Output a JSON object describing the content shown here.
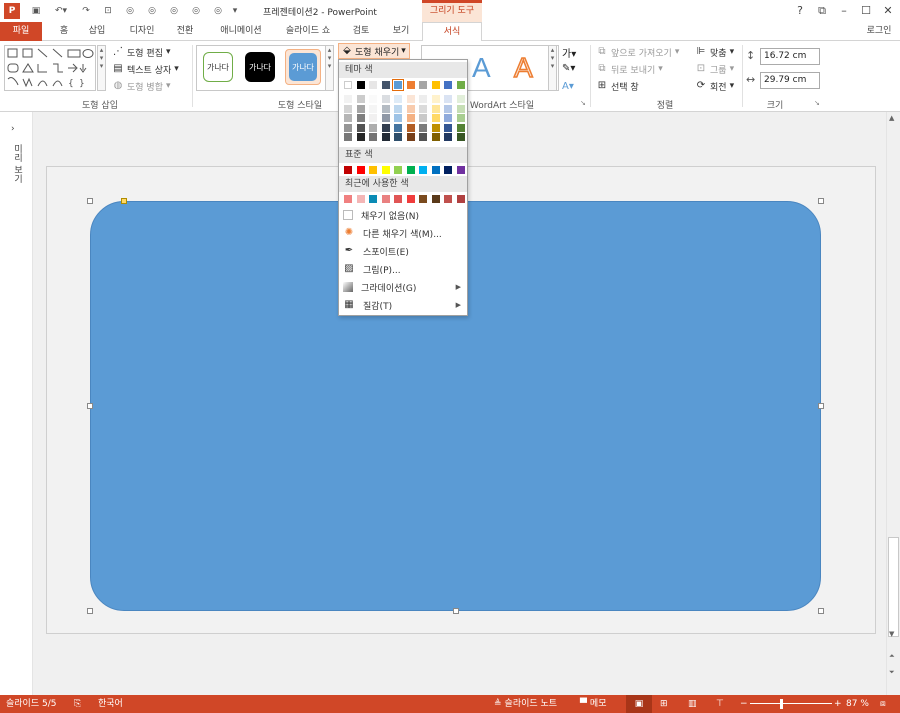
{
  "titlebar": {
    "title": "프레젠테이션2 - PowerPoint",
    "context_tab": "그리기 도구",
    "help": "?",
    "restore": "⧉",
    "minimize": "–",
    "maximize": "☐",
    "close": "✕"
  },
  "tabs": {
    "file": "파일",
    "home": "홈",
    "insert": "삽입",
    "design": "디자인",
    "transitions": "전환",
    "animations": "애니메이션",
    "slideshow": "슬라이드 쇼",
    "review": "검토",
    "view": "보기",
    "format": "서식",
    "login": "로그인"
  },
  "ribbon": {
    "insert_shapes": {
      "label": "도형 삽입",
      "edit_shape": "도형 편집",
      "text_box": "텍스트 상자",
      "merge_shapes": "도형 병합"
    },
    "shape_styles": {
      "label": "도형 스타일",
      "sample": "가나다",
      "fill_button": "도형 채우기"
    },
    "wordart": {
      "label": "WordArt 스타일",
      "letter": "A"
    },
    "arrange": {
      "label": "정렬",
      "bring_forward": "앞으로 가져오기",
      "send_backward": "뒤로 보내기",
      "selection_pane": "선택 창",
      "align": "맞춤",
      "group": "그룹",
      "rotate": "회전"
    },
    "size": {
      "label": "크기",
      "height": "16.72 cm",
      "width": "29.79 cm"
    }
  },
  "leftpane": {
    "label": "미리 보기"
  },
  "dropdown": {
    "theme_colors": "테마 색",
    "standard_colors": "표준 색",
    "recent_colors": "최근에 사용한 색",
    "no_fill": "채우기 없음(N)",
    "more_fill": "다른 채우기 색(M)...",
    "eyedropper": "스포이트(E)",
    "picture": "그림(P)...",
    "gradient": "그라데이션(G)",
    "texture": "질감(T)",
    "theme_row": [
      "#ffffff",
      "#000000",
      "#e7e6e6",
      "#44546a",
      "#5b9bd5",
      "#ed7d31",
      "#a5a5a5",
      "#ffc000",
      "#4472c4",
      "#70ad47"
    ],
    "standard_row": [
      "#c00000",
      "#ff0000",
      "#ffc000",
      "#ffff00",
      "#92d050",
      "#00b050",
      "#00b0f0",
      "#0070c0",
      "#002060",
      "#7030a0"
    ],
    "recent_row": [
      "#f08080",
      "#f4b6b6",
      "#0a8bb5",
      "#e98080",
      "#e05555",
      "#f03c3c",
      "#7a4a1e",
      "#5a3a1a",
      "#c0504d",
      "#b04040"
    ]
  },
  "statusbar": {
    "slide": "슬라이드 5/5",
    "language": "한국어",
    "notes": "슬라이드 노트",
    "comments": "메모",
    "zoom": "87 %"
  },
  "colors": {
    "accent": "#d04727",
    "shape_fill": "#5b9bd5"
  }
}
